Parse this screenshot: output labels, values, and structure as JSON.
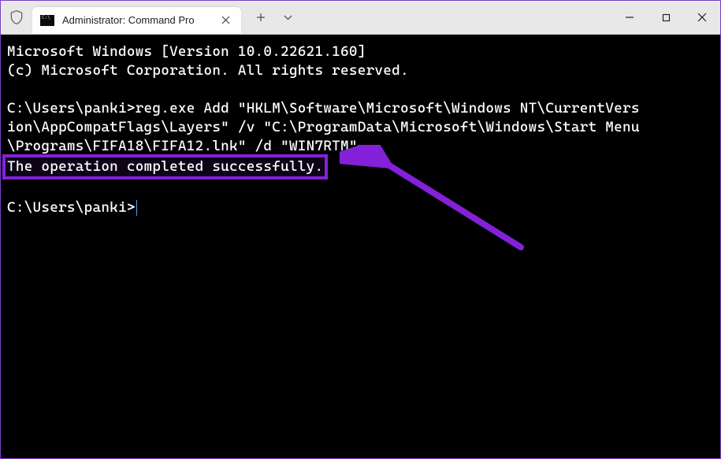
{
  "window": {
    "tab_title": "Administrator: Command Pro",
    "tab_icon_text": "C:\\"
  },
  "terminal": {
    "banner_line1": "Microsoft Windows [Version 10.0.22621.160]",
    "banner_line2": "(c) Microsoft Corporation. All rights reserved.",
    "cmd_line1": "C:\\Users\\panki>reg.exe Add \"HKLM\\Software\\Microsoft\\Windows NT\\CurrentVers",
    "cmd_line2": "ion\\AppCompatFlags\\Layers\" /v \"C:\\ProgramData\\Microsoft\\Windows\\Start Menu",
    "cmd_line3": "\\Programs\\FIFA18\\FIFA12.lnk\" /d \"WIN7RTM\"",
    "success_msg": "The operation completed successfully.",
    "prompt2": "C:\\Users\\panki>"
  },
  "annotation": {
    "color": "#8421d8"
  }
}
